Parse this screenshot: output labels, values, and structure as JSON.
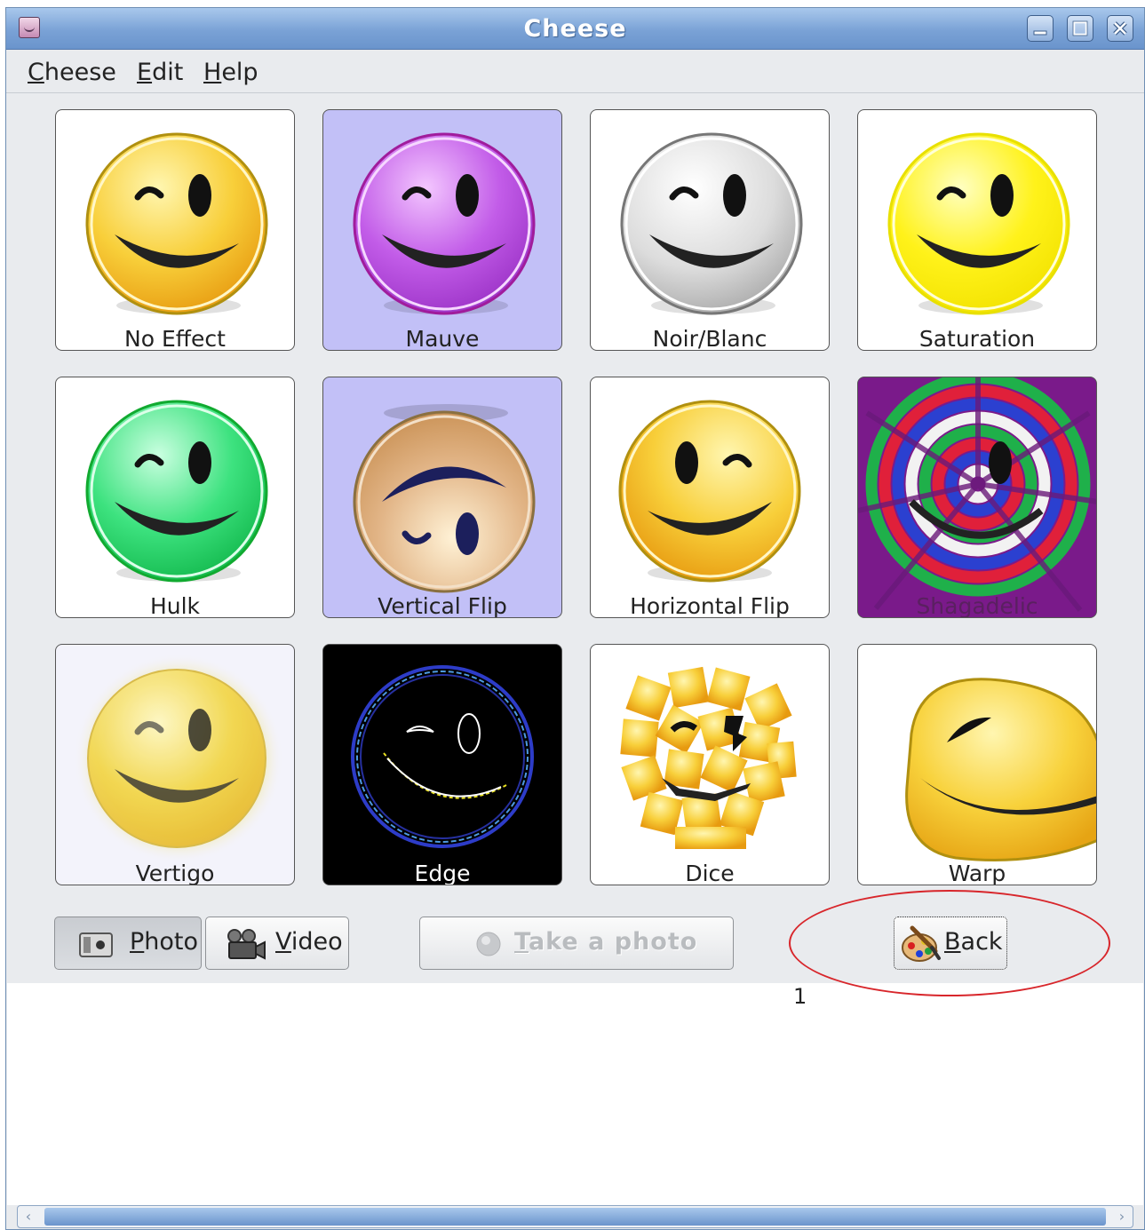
{
  "window": {
    "title": "Cheese"
  },
  "menu": {
    "items": [
      {
        "label": "heese",
        "mnemonic": "C"
      },
      {
        "label": "dit",
        "mnemonic": "E"
      },
      {
        "label": "elp",
        "mnemonic": "H"
      }
    ]
  },
  "effects": [
    {
      "label": "No Effect",
      "selected": false
    },
    {
      "label": "Mauve",
      "selected": true
    },
    {
      "label": "Noir/Blanc",
      "selected": false
    },
    {
      "label": "Saturation",
      "selected": false
    },
    {
      "label": "Hulk",
      "selected": false
    },
    {
      "label": "Vertical Flip",
      "selected": true
    },
    {
      "label": "Horizontal Flip",
      "selected": false
    },
    {
      "label": "Shagadelic",
      "selected": false
    },
    {
      "label": "Vertigo",
      "selected": false
    },
    {
      "label": "Edge",
      "selected": false
    },
    {
      "label": "Dice",
      "selected": false
    },
    {
      "label": "Warp",
      "selected": false
    }
  ],
  "toolbar": {
    "photo": {
      "mnemonic": "P",
      "rest": "hoto"
    },
    "video": {
      "mnemonic": "V",
      "rest": "ideo"
    },
    "take_photo": {
      "mnemonic": "T",
      "rest": "ake a photo"
    },
    "back": {
      "mnemonic": "B",
      "rest": "ack"
    }
  },
  "annotation": {
    "number": "1",
    "color": "#d8262b"
  },
  "colors": {
    "titlebar": "#7aa2d6",
    "selected_effect": "#c2c0f7"
  }
}
